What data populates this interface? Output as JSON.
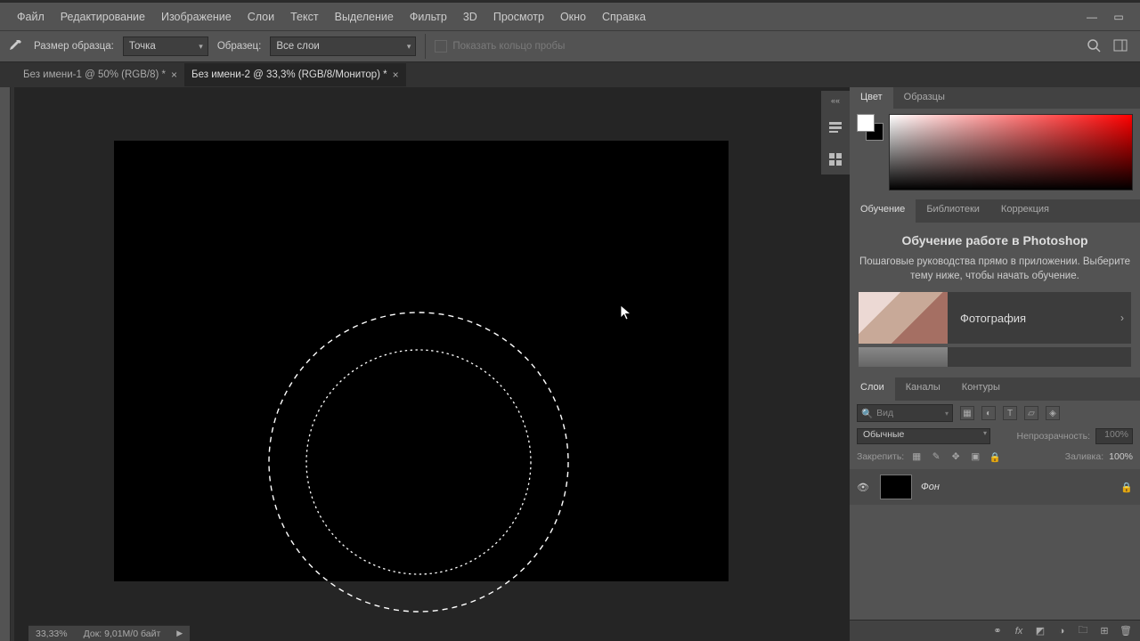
{
  "menu": {
    "file": "Файл",
    "edit": "Редактирование",
    "image": "Изображение",
    "layer": "Слои",
    "text": "Текст",
    "select": "Выделение",
    "filter": "Фильтр",
    "threeD": "3D",
    "view": "Просмотр",
    "window": "Окно",
    "help": "Справка"
  },
  "optbar": {
    "sample_size_label": "Размер образца:",
    "sample_size_value": "Точка",
    "sample_label": "Образец:",
    "sample_value": "Все слои",
    "ring_label": "Показать кольцо пробы"
  },
  "tabs": {
    "t1": "Без имени-1 @ 50% (RGB/8) *",
    "t2": "Без имени-2 @ 33,3% (RGB/8/Монитор) *"
  },
  "rpanel": {
    "collapse": "««",
    "color_tab": "Цвет",
    "swatches_tab": "Образцы",
    "learn_tab": "Обучение",
    "libs_tab": "Библиотеки",
    "corr_tab": "Коррекция",
    "learn_title": "Обучение работе в Photoshop",
    "learn_sub": "Пошаговые руководства прямо в приложении. Выберите тему ниже, чтобы начать обучение.",
    "card_photo": "Фотография",
    "layers_tab": "Слои",
    "channels_tab": "Каналы",
    "paths_tab": "Контуры",
    "search_placeholder": "Вид",
    "blend_mode": "Обычные",
    "opacity_label": "Непрозрачность:",
    "opacity_value": "100%",
    "fill_label": "Заливка:",
    "fill_value": "100%",
    "lock_label": "Закрепить:",
    "layer1_name": "Фон"
  },
  "statusbar": {
    "zoom": "33,33%",
    "doc": "Док: 9,01M/0 байт"
  }
}
